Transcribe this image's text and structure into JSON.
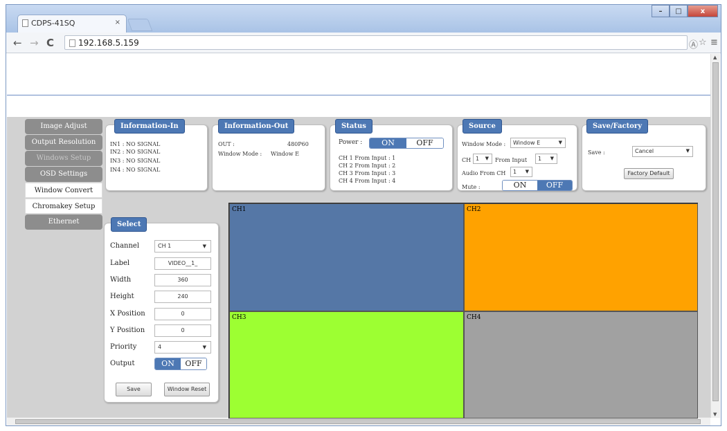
{
  "browser": {
    "tab_title": "CDPS-41SQ",
    "tab_close": "×",
    "url": "192.168.5.159",
    "nav_back": "←",
    "nav_forward": "→",
    "nav_reload": "C",
    "win_min": "–",
    "win_max": "□",
    "win_close": "x",
    "toolbar_icons": [
      "Ⓐ",
      "☆",
      "≡"
    ]
  },
  "menu": {
    "items": [
      {
        "label": "Image Adjust",
        "state": "normal"
      },
      {
        "label": "Output Resolution",
        "state": "normal"
      },
      {
        "label": "Windows Setup",
        "state": "disabled"
      },
      {
        "label": "OSD Settings",
        "state": "normal"
      },
      {
        "label": "Window Convert",
        "state": "white"
      },
      {
        "label": "Chromakey Setup",
        "state": "white"
      },
      {
        "label": "Ethernet",
        "state": "normal"
      }
    ]
  },
  "info_in": {
    "title": "Information-In",
    "lines": [
      "IN1 : NO SIGNAL",
      "IN2 : NO SIGNAL",
      "IN3 : NO SIGNAL",
      "IN4 : NO SIGNAL"
    ]
  },
  "info_out": {
    "title": "Information-Out",
    "out_label": "OUT :",
    "out_value": "480P60",
    "mode_label": "Window Mode :",
    "mode_value": "Window E"
  },
  "status": {
    "title": "Status",
    "power_label": "Power :",
    "on": "ON",
    "off": "OFF",
    "lines": [
      "CH 1 From Input : 1",
      "CH 2 From Input : 2",
      "CH 3 From Input : 3",
      "CH 4 From Input : 4"
    ]
  },
  "source": {
    "title": "Source",
    "window_mode_label": "Window Mode :",
    "window_mode_value": "Window E",
    "ch_label": "CH",
    "ch_value": "1",
    "from_input_label": "From Input",
    "from_input_value": "1",
    "audio_label": "Audio From CH",
    "audio_value": "1",
    "mute_label": "Mute :",
    "on": "ON",
    "off": "OFF"
  },
  "save_factory": {
    "title": "Save/Factory",
    "save_label": "Save :",
    "save_value": "Cancel",
    "factory_button": "Factory Default"
  },
  "select": {
    "title": "Select",
    "fields": [
      {
        "label": "Channel",
        "value": "CH 1",
        "type": "select"
      },
      {
        "label": "Label",
        "value": "VIDEO__1_",
        "type": "text"
      },
      {
        "label": "Width",
        "value": "360",
        "type": "text"
      },
      {
        "label": "Height",
        "value": "240",
        "type": "text"
      },
      {
        "label": "X Position",
        "value": "0",
        "type": "text"
      },
      {
        "label": "Y Position",
        "value": "0",
        "type": "text"
      },
      {
        "label": "Priority",
        "value": "4",
        "type": "select"
      }
    ],
    "output_label": "Output",
    "on": "ON",
    "off": "OFF",
    "save_button": "Save",
    "reset_button": "Window Reset"
  },
  "preview": {
    "channels": [
      {
        "label": "CH1",
        "color": "#5577a6"
      },
      {
        "label": "CH2",
        "color": "#ffa200"
      },
      {
        "label": "CH3",
        "color": "#9dff32"
      },
      {
        "label": "CH4",
        "color": "#a1a1a1"
      }
    ]
  }
}
